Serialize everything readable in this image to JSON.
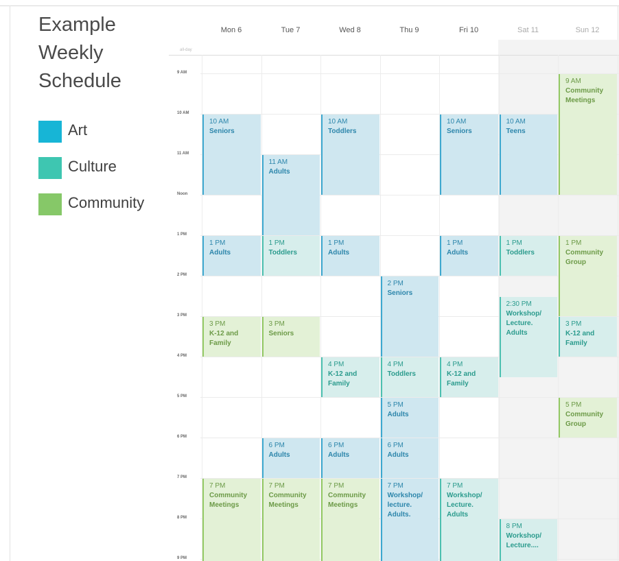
{
  "sidebar": {
    "title_lines": [
      "Example",
      "Weekly",
      "Schedule"
    ],
    "legend": [
      {
        "label": "Art",
        "color": "#17b5d6"
      },
      {
        "label": "Culture",
        "color": "#3ec6b1"
      },
      {
        "label": "Community",
        "color": "#86c868"
      }
    ]
  },
  "calendar": {
    "days": [
      {
        "label": "Mon 6",
        "weekend": false
      },
      {
        "label": "Tue 7",
        "weekend": false
      },
      {
        "label": "Wed 8",
        "weekend": false
      },
      {
        "label": "Thu 9",
        "weekend": false
      },
      {
        "label": "Fri 10",
        "weekend": false
      },
      {
        "label": "Sat 11",
        "weekend": true
      },
      {
        "label": "Sun 12",
        "weekend": true
      }
    ],
    "all_day_label": "all-day",
    "hours": [
      "9 AM",
      "10 AM",
      "11 AM",
      "Noon",
      "1 PM",
      "2 PM",
      "3 PM",
      "4 PM",
      "5 PM",
      "6 PM",
      "7 PM",
      "8 PM",
      "9 PM"
    ],
    "events": [
      {
        "day": 0,
        "start": 10,
        "end": 12,
        "time": "10 AM",
        "title": "Seniors",
        "category": "art"
      },
      {
        "day": 0,
        "start": 13,
        "end": 14,
        "time": "1 PM",
        "title": "Adults",
        "category": "art"
      },
      {
        "day": 0,
        "start": 15,
        "end": 16,
        "time": "3 PM",
        "title": "K-12 and Family",
        "category": "community"
      },
      {
        "day": 0,
        "start": 19,
        "end": 21.3,
        "time": "7 PM",
        "title": "Community Meetings",
        "category": "community"
      },
      {
        "day": 1,
        "start": 11,
        "end": 13,
        "time": "11 AM",
        "title": "Adults",
        "category": "art"
      },
      {
        "day": 1,
        "start": 13,
        "end": 14,
        "time": "1 PM",
        "title": "Toddlers",
        "category": "culture"
      },
      {
        "day": 1,
        "start": 15,
        "end": 16,
        "time": "3 PM",
        "title": "Seniors",
        "category": "community"
      },
      {
        "day": 1,
        "start": 18,
        "end": 19,
        "time": "6 PM",
        "title": "Adults",
        "category": "art"
      },
      {
        "day": 1,
        "start": 19,
        "end": 21.3,
        "time": "7 PM",
        "title": "Community Meetings",
        "category": "community"
      },
      {
        "day": 2,
        "start": 10,
        "end": 12,
        "time": "10 AM",
        "title": "Toddlers",
        "category": "art"
      },
      {
        "day": 2,
        "start": 13,
        "end": 14,
        "time": "1 PM",
        "title": "Adults",
        "category": "art"
      },
      {
        "day": 2,
        "start": 16,
        "end": 17,
        "time": "4 PM",
        "title": "K-12 and Family",
        "category": "culture"
      },
      {
        "day": 2,
        "start": 18,
        "end": 19,
        "time": "6 PM",
        "title": "Adults",
        "category": "art"
      },
      {
        "day": 2,
        "start": 19,
        "end": 21.3,
        "time": "7 PM",
        "title": "Community Meetings",
        "category": "community"
      },
      {
        "day": 3,
        "start": 14,
        "end": 16,
        "time": "2 PM",
        "title": "Seniors",
        "category": "art"
      },
      {
        "day": 3,
        "start": 16,
        "end": 17,
        "time": "4 PM",
        "title": "Toddlers",
        "category": "culture"
      },
      {
        "day": 3,
        "start": 17,
        "end": 18,
        "time": "5 PM",
        "title": "Adults",
        "category": "art"
      },
      {
        "day": 3,
        "start": 18,
        "end": 19,
        "time": "6 PM",
        "title": "Adults",
        "category": "art"
      },
      {
        "day": 3,
        "start": 19,
        "end": 21.3,
        "time": "7 PM",
        "title": "Workshop/ lecture. Adults.",
        "category": "art"
      },
      {
        "day": 4,
        "start": 10,
        "end": 12,
        "time": "10 AM",
        "title": "Seniors",
        "category": "art"
      },
      {
        "day": 4,
        "start": 13,
        "end": 14,
        "time": "1 PM",
        "title": "Adults",
        "category": "art"
      },
      {
        "day": 4,
        "start": 16,
        "end": 17,
        "time": "4 PM",
        "title": "K-12 and Family",
        "category": "culture"
      },
      {
        "day": 4,
        "start": 19,
        "end": 21.3,
        "time": "7 PM",
        "title": "Workshop/ Lecture. Adults",
        "category": "culture"
      },
      {
        "day": 5,
        "start": 10,
        "end": 12,
        "time": "10 AM",
        "title": "Teens",
        "category": "art"
      },
      {
        "day": 5,
        "start": 13,
        "end": 14,
        "time": "1 PM",
        "title": "Toddlers",
        "category": "culture"
      },
      {
        "day": 5,
        "start": 14.5,
        "end": 16.5,
        "time": "2:30 PM",
        "title": "Workshop/ Lecture. Adults",
        "category": "culture"
      },
      {
        "day": 5,
        "start": 20,
        "end": 21.3,
        "time": "8 PM",
        "title": "Workshop/ Lecture....",
        "category": "culture"
      },
      {
        "day": 6,
        "start": 9,
        "end": 12,
        "time": "9 AM",
        "title": "Community Meetings",
        "category": "community"
      },
      {
        "day": 6,
        "start": 13,
        "end": 15,
        "time": "1 PM",
        "title": "Community Group",
        "category": "community"
      },
      {
        "day": 6,
        "start": 15,
        "end": 16,
        "time": "3 PM",
        "title": "K-12 and Family",
        "category": "culture"
      },
      {
        "day": 6,
        "start": 17,
        "end": 18,
        "time": "5 PM",
        "title": "Community Group",
        "category": "community"
      }
    ]
  }
}
